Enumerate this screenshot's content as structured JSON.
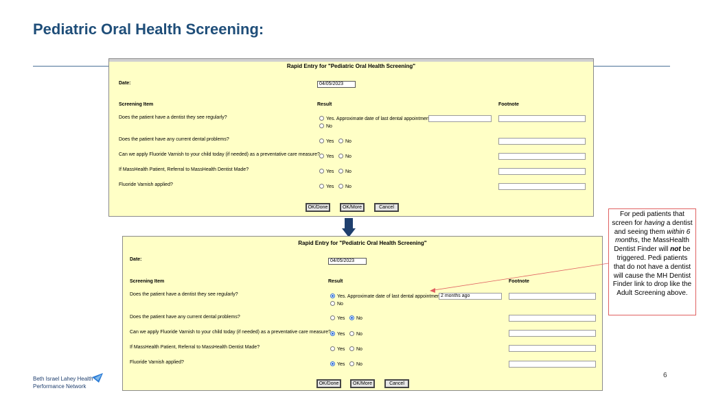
{
  "slide": {
    "title": "Pediatric Oral Health Screening:",
    "page_number": "6",
    "logo_line1": "Beth Israel Lahey Health",
    "logo_line2": "Performance Network"
  },
  "form_top": {
    "title": "Rapid Entry for \"Pediatric Oral Health Screening\"",
    "date_label": "Date:",
    "date_value": "04/05/2023",
    "col_item": "Screening Item",
    "col_result": "Result",
    "col_footnote": "Footnote",
    "rows": [
      {
        "item": "Does the patient have a dentist they see regularly?",
        "yes": "Yes. Approximate date of last dental appointment:",
        "no": "No",
        "yes_selected": false,
        "no_selected": false,
        "date_value": ""
      },
      {
        "item": "Does the patient have any current dental problems?",
        "yes": "Yes",
        "no": "No",
        "yes_selected": false,
        "no_selected": false
      },
      {
        "item": "Can we apply Fluoride Varnish to your child today (if needed) as a preventative care measure?",
        "yes": "Yes",
        "no": "No",
        "yes_selected": false,
        "no_selected": false
      },
      {
        "item": "If MassHealth Patient, Referral to MassHealth Dentist Made?",
        "yes": "Yes",
        "no": "No",
        "yes_selected": false,
        "no_selected": false
      },
      {
        "item": "Fluoride Varnish applied?",
        "yes": "Yes",
        "no": "No",
        "yes_selected": false,
        "no_selected": false
      }
    ],
    "buttons": {
      "ok_done": "OK/Done",
      "ok_more": "OK/More",
      "cancel": "Cancel"
    }
  },
  "form_bottom": {
    "title": "Rapid Entry for \"Pediatric Oral Health Screening\"",
    "date_label": "Date:",
    "date_value": "04/05/2023",
    "col_item": "Screening Item",
    "col_result": "Result",
    "col_footnote": "Footnote",
    "rows": [
      {
        "item": "Does the patient have a dentist they see regularly?",
        "yes": "Yes. Approximate date of last dental appointment:",
        "no": "No",
        "yes_selected": true,
        "no_selected": false,
        "date_value": "2 months ago"
      },
      {
        "item": "Does the patient have any current dental problems?",
        "yes": "Yes",
        "no": "No",
        "yes_selected": false,
        "no_selected": true
      },
      {
        "item": "Can we apply Fluoride Varnish to your child today (if needed) as a preventative care measure?",
        "yes": "Yes",
        "no": "No",
        "yes_selected": true,
        "no_selected": false
      },
      {
        "item": "If MassHealth Patient, Referral to MassHealth Dentist Made?",
        "yes": "Yes",
        "no": "No",
        "yes_selected": false,
        "no_selected": false
      },
      {
        "item": "Fluoride Varnish applied?",
        "yes": "Yes",
        "no": "No",
        "yes_selected": true,
        "no_selected": false
      }
    ],
    "buttons": {
      "ok_done": "OK/Done",
      "ok_more": "OK/More",
      "cancel": "Cancel"
    }
  },
  "callout": {
    "t1": "For pedi patients that screen for ",
    "t2": "having",
    "t3": " a dentist and seeing them ",
    "t4": "within 6 months",
    "t5": ", the MassHealth Dentist Finder will ",
    "t6": "not",
    "t7": " be triggered. Pedi patients that do not have a dentist will cause the MH Dentist Finder link to drop like the Adult Screening above."
  },
  "colors": {
    "title": "#1f4e79",
    "panel_bg": "#ffffc6",
    "arrow": "#1f3f6e",
    "callout_border": "#e06060",
    "radio_selected": "#2a6cd6"
  },
  "icons": [
    "down-arrow-icon",
    "bilh-logo-icon",
    "radio-icon"
  ]
}
